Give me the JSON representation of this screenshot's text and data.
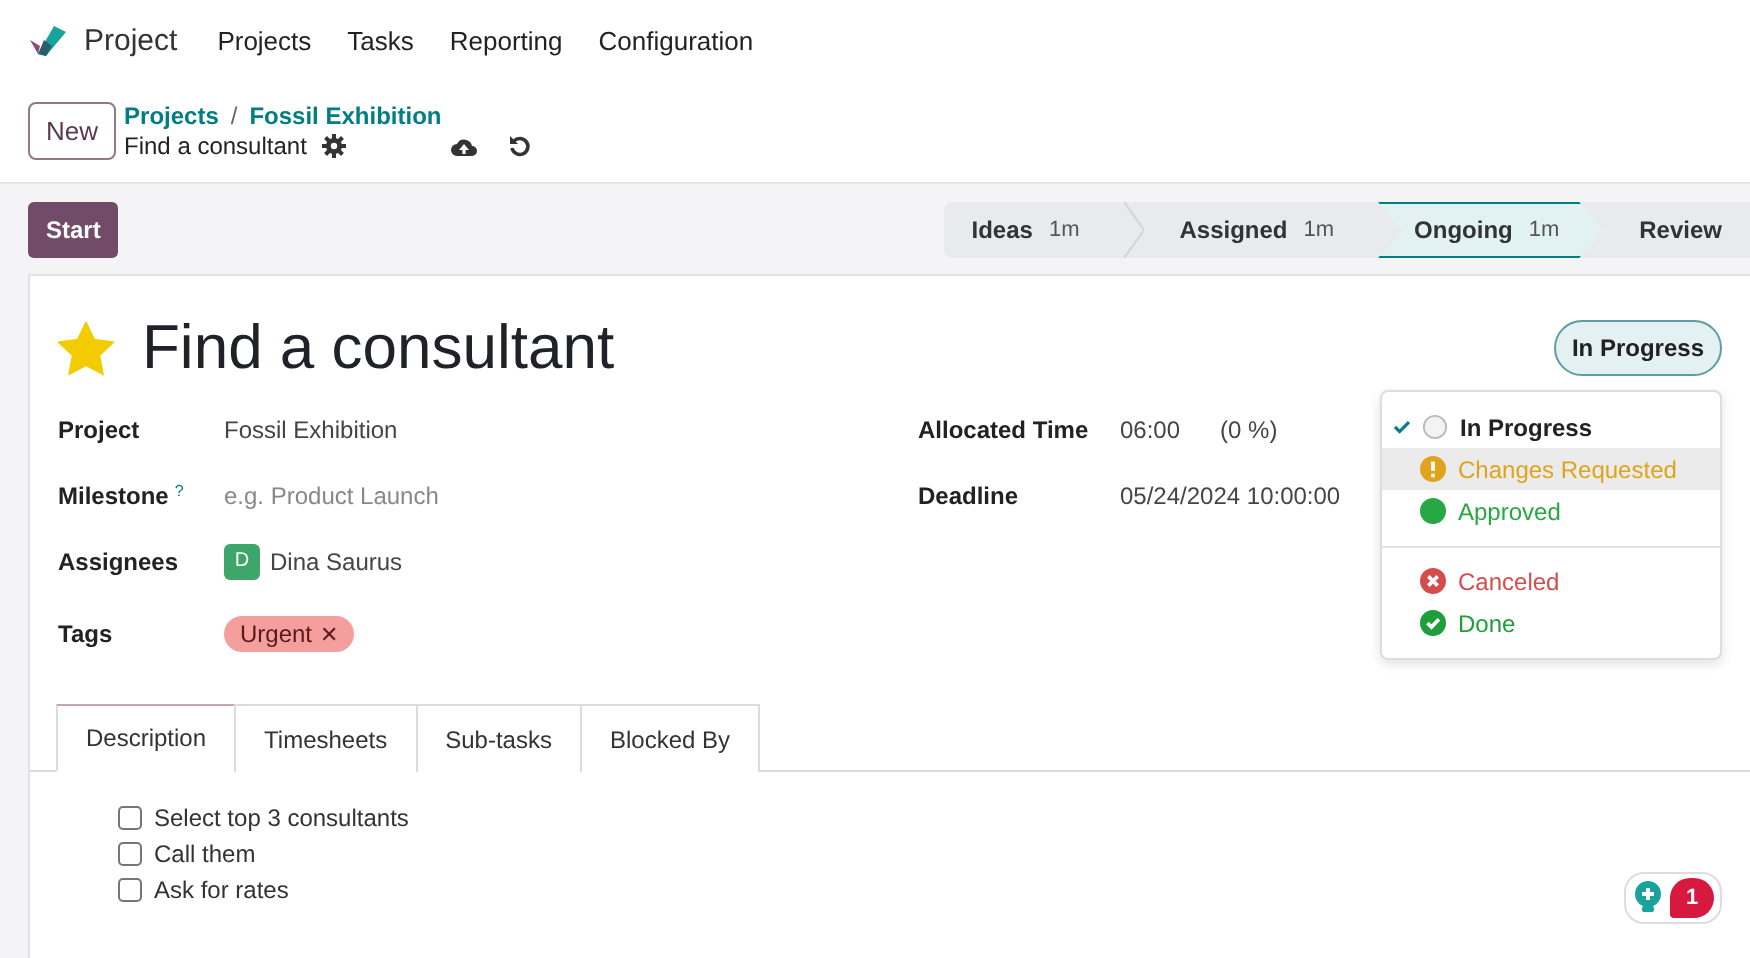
{
  "navbar": {
    "app_name": "Project",
    "menu": [
      "Projects",
      "Tasks",
      "Reporting",
      "Configuration"
    ]
  },
  "control_panel": {
    "new_button": "New",
    "breadcrumbs": [
      "Projects",
      "Fossil Exhibition"
    ],
    "breadcrumb_separator": "/",
    "record_name": "Find a consultant"
  },
  "status_bar": {
    "start_button": "Start",
    "stages": [
      {
        "name": "Ideas",
        "time": "1m",
        "selected": false
      },
      {
        "name": "Assigned",
        "time": "1m",
        "selected": false
      },
      {
        "name": "Ongoing",
        "time": "1m",
        "selected": true
      },
      {
        "name": "Review",
        "selected": false
      }
    ]
  },
  "task": {
    "title": "Find a consultant",
    "starred": true,
    "state_button": "In Progress",
    "left_fields": [
      {
        "label": "Project",
        "kind": "text",
        "value": "Fossil Exhibition"
      },
      {
        "label": "Milestone",
        "help": "?",
        "kind": "input",
        "placeholder": "e.g. Product Launch"
      },
      {
        "label": "Assignees",
        "kind": "user",
        "avatar": "D",
        "value": "Dina Saurus"
      },
      {
        "label": "Tags",
        "kind": "tag",
        "value": "Urgent",
        "remove": "✕"
      }
    ],
    "right_fields": [
      {
        "label": "Allocated Time",
        "value": "06:00",
        "extra": "(0 %)"
      },
      {
        "label": "Deadline",
        "value": "05/24/2024 10:00:00"
      }
    ]
  },
  "state_menu": [
    {
      "label": "In Progress",
      "kind": "empty",
      "color": "#222222",
      "selected": true,
      "highlighted": false
    },
    {
      "label": "Changes Requested",
      "kind": "warning",
      "color": "#e0a31c",
      "selected": false,
      "highlighted": true
    },
    {
      "label": "Approved",
      "kind": "dot",
      "color": "#28a745",
      "selected": false,
      "highlighted": false
    },
    {
      "label": "Canceled",
      "kind": "cancel",
      "color": "#d44c4c",
      "selected": false,
      "highlighted": false,
      "separator_before": true
    },
    {
      "label": "Done",
      "kind": "done",
      "color": "#1e9e3a",
      "selected": false,
      "highlighted": false
    }
  ],
  "tabs": [
    {
      "label": "Description",
      "selected": true
    },
    {
      "label": "Timesheets",
      "selected": false
    },
    {
      "label": "Sub-tasks",
      "selected": false
    },
    {
      "label": "Blocked By",
      "selected": false
    }
  ],
  "checklist": [
    {
      "text": "Select top 3 consultants",
      "checked": false
    },
    {
      "text": "Call them",
      "checked": false
    },
    {
      "text": "Ask for rates",
      "checked": false
    }
  ],
  "chatter_badge": {
    "count": "1"
  }
}
